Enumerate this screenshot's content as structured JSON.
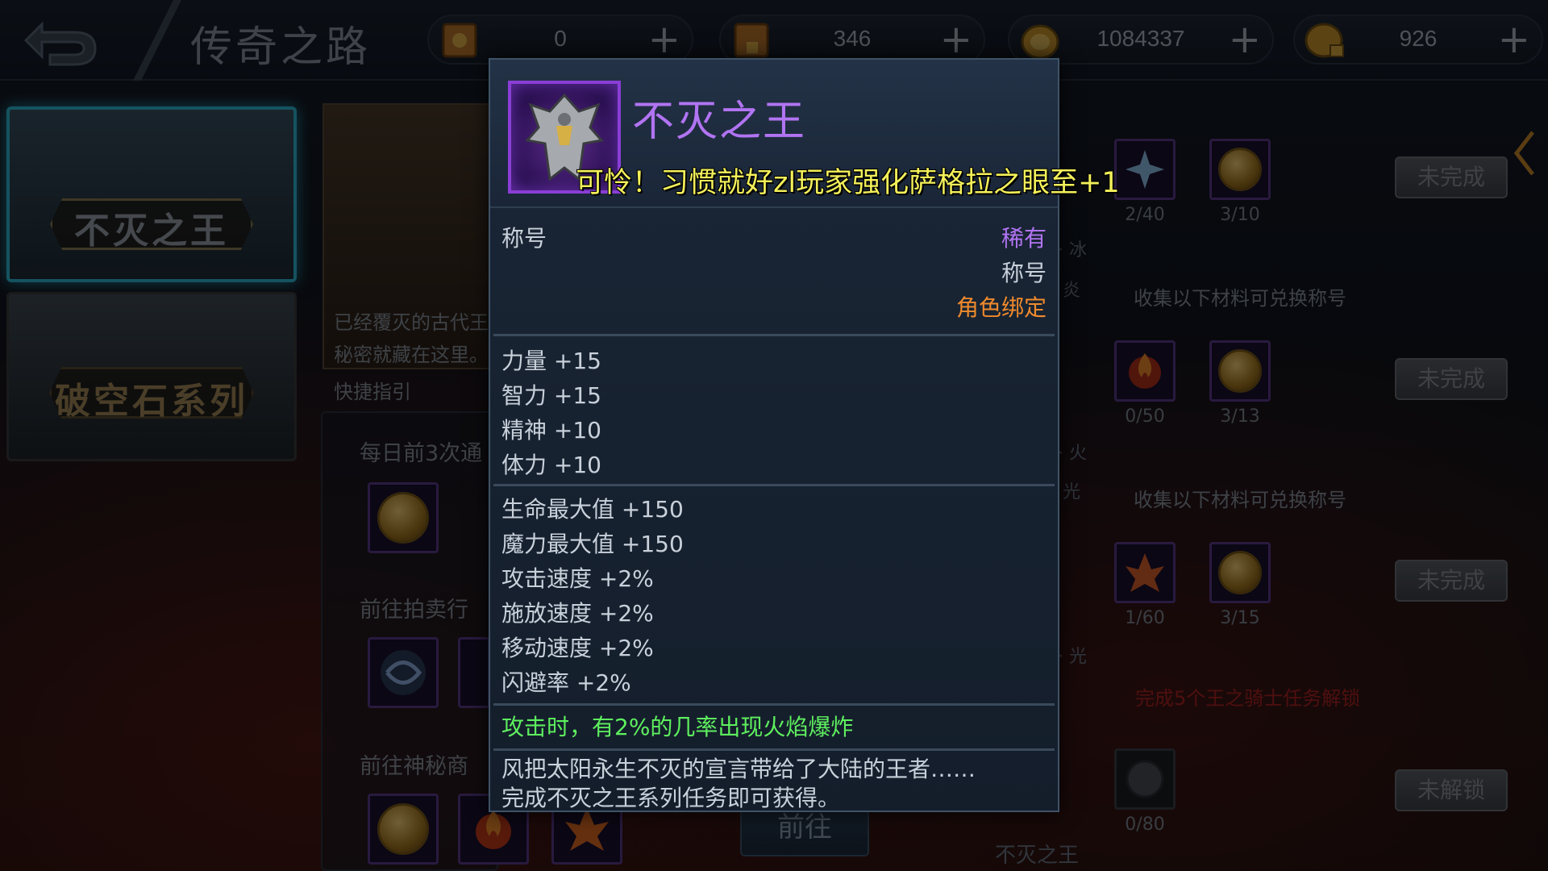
{
  "header": {
    "title": "传奇之路",
    "resources": [
      {
        "name": "scroll-1",
        "value": "0"
      },
      {
        "name": "scroll-2",
        "value": "346"
      },
      {
        "name": "gold-coin",
        "value": "1084337"
      },
      {
        "name": "bound-coin",
        "value": "926"
      }
    ],
    "plus": "+"
  },
  "menu": {
    "items": [
      {
        "label": "不灭之王",
        "active": true
      },
      {
        "label": "破空石系列",
        "active": false
      }
    ]
  },
  "middle": {
    "desc_line1": "已经覆灭的古代王",
    "desc_line2": "秘密就藏在这里。",
    "guide": "快捷指引",
    "daily": "每日前3次通",
    "auction": "前往拍卖行",
    "mystery": "前往神秘商",
    "goto": "前往"
  },
  "right": {
    "collect_text": "收集以下材料可兑换称号",
    "rows": [
      {
        "count_a": "2/40",
        "count_b": "3/10",
        "status": "未完成"
      },
      {
        "count_a": "0/50",
        "count_b": "3/13",
        "status": "未完成"
      },
      {
        "count_a": "1/60",
        "count_b": "3/15",
        "status": "未完成"
      },
      {
        "count_a": "0/80",
        "status": "未解锁"
      }
    ],
    "side_labels": [
      "· 冰",
      "炎",
      "· 火",
      "光",
      "· 光"
    ],
    "lock_note": "完成5个王之骑士任务解锁",
    "bottom_label": "不灭之王"
  },
  "tooltip": {
    "title": "不灭之王",
    "banner": "可怜！习惯就好zl玩家强化萨格拉之眼至+1",
    "type_label": "称号",
    "rarity": "稀有",
    "category": "称号",
    "binding": "角色绑定",
    "base_stats": [
      "力量 +15",
      "智力 +15",
      "精神 +10",
      "体力 +10"
    ],
    "extra_stats": [
      "生命最大值 +150",
      "魔力最大值 +150",
      "攻击速度 +2%",
      "施放速度 +2%",
      "移动速度 +2%",
      "闪避率 +2%"
    ],
    "effect": "攻击时，有2%的几率出现火焰爆炸",
    "desc_line1": "风把太阳永生不灭的宣言带给了大陆的王者……",
    "desc_line2": "完成不灭之王系列任务即可获得。",
    "colors": {
      "title": "#b174f2",
      "rarity": "#b174f2",
      "binding": "#f08a2c",
      "effect": "#5ef05e",
      "banner": "#f3f05a"
    }
  }
}
